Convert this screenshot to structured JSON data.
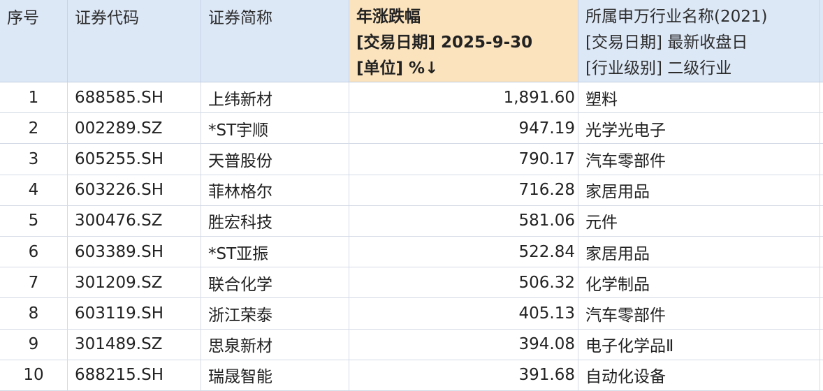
{
  "header": {
    "seq": "序号",
    "code": "证券代码",
    "name": "证券简称",
    "change": {
      "line1": "年涨跌幅",
      "line2": "[交易日期] 2025-9-30",
      "line3": "[单位] %↓"
    },
    "industry": {
      "line1": "所属申万行业名称(2021)",
      "line2": "[交易日期] 最新收盘日",
      "line3": "[行业级别] 二级行业"
    }
  },
  "rows": [
    {
      "seq": "1",
      "code": "688585.SH",
      "name": "上纬新材",
      "change": "1,891.60",
      "industry": "塑料"
    },
    {
      "seq": "2",
      "code": "002289.SZ",
      "name": "*ST宇顺",
      "change": "947.19",
      "industry": "光学光电子"
    },
    {
      "seq": "3",
      "code": "605255.SH",
      "name": "天普股份",
      "change": "790.17",
      "industry": "汽车零部件"
    },
    {
      "seq": "4",
      "code": "603226.SH",
      "name": "菲林格尔",
      "change": "716.28",
      "industry": "家居用品"
    },
    {
      "seq": "5",
      "code": "300476.SZ",
      "name": "胜宏科技",
      "change": "581.06",
      "industry": "元件"
    },
    {
      "seq": "6",
      "code": "603389.SH",
      "name": "*ST亚振",
      "change": "522.84",
      "industry": "家居用品"
    },
    {
      "seq": "7",
      "code": "301209.SZ",
      "name": "联合化学",
      "change": "506.32",
      "industry": "化学制品"
    },
    {
      "seq": "8",
      "code": "603119.SH",
      "name": "浙江荣泰",
      "change": "405.13",
      "industry": "汽车零部件"
    },
    {
      "seq": "9",
      "code": "301489.SZ",
      "name": "思泉新材",
      "change": "394.08",
      "industry": "电子化学品Ⅱ"
    },
    {
      "seq": "10",
      "code": "688215.SH",
      "name": "瑞晟智能",
      "change": "391.68",
      "industry": "自动化设备"
    }
  ]
}
